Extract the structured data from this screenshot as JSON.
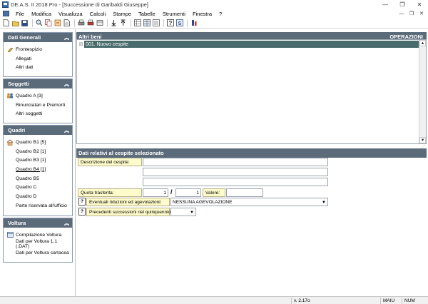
{
  "window": {
    "title": "DE.A.S. II 2018 Pro - [Successione di Garibaldi Giuseppe]",
    "minimize": "—",
    "restore": "❐",
    "close": "✕"
  },
  "menu": {
    "items": [
      "File",
      "Modifica",
      "Visualizza",
      "Calcoli",
      "Stampe",
      "Tabelle",
      "Strumenti",
      "Finestra",
      "?"
    ]
  },
  "toolbar": {
    "buttons": [
      "new-icon",
      "open-icon",
      "save-icon",
      "search-icon",
      "copy-icon",
      "cut-icon",
      "document-icon",
      "print-icon",
      "print-preview-icon",
      "archive-icon",
      "down-arrow-icon",
      "up-arrow-icon",
      "grid-icon",
      "table-icon",
      "list-icon",
      "help-icon",
      "calc-icon",
      "building-icon"
    ]
  },
  "left": {
    "groups": [
      {
        "title": "Dati Generali",
        "items": [
          {
            "label": "Frontespizio",
            "icon": "pen-icon",
            "underline": false
          },
          {
            "label": "Allegati",
            "icon": "",
            "underline": false
          },
          {
            "label": "Altri dati",
            "icon": "",
            "underline": false
          }
        ]
      },
      {
        "title": "Soggetti",
        "items": [
          {
            "label": "Quadro A [3]",
            "icon": "people-icon",
            "underline": false
          },
          {
            "label": "Rinunciatari e Premorti",
            "icon": "",
            "underline": false
          },
          {
            "label": "Altri soggetti",
            "icon": "",
            "underline": false
          }
        ]
      },
      {
        "title": "Quadri",
        "items": [
          {
            "label": "Quadro B1 [5]",
            "icon": "house-icon",
            "underline": false
          },
          {
            "label": "Quadro B2 [1]",
            "icon": "",
            "underline": false
          },
          {
            "label": "Quadro B3 [1]",
            "icon": "",
            "underline": false
          },
          {
            "label": "Quadro B4 [1]",
            "icon": "",
            "underline": true
          },
          {
            "label": "Quadro B5",
            "icon": "",
            "underline": false
          },
          {
            "label": "Quadro C",
            "icon": "",
            "underline": false
          },
          {
            "label": "Quadro D",
            "icon": "",
            "underline": false
          },
          {
            "label": "Parte riservata all'ufficio",
            "icon": "",
            "underline": false
          }
        ]
      },
      {
        "title": "Voltura",
        "items": [
          {
            "label": "Compilazione Voltura",
            "icon": "form-icon",
            "underline": false
          },
          {
            "label": "Dati per Voltura 1.1 (.DAT)",
            "icon": "",
            "underline": false
          },
          {
            "label": "Dati per Voltura cartacea",
            "icon": "",
            "underline": false
          }
        ]
      }
    ]
  },
  "main": {
    "section_title": "Altri beni",
    "operations_label": "OPERAZIONI",
    "tree_item": "001. Nuovo cespite",
    "details_title": "Dati relativi al cespite selezionato",
    "descrizione_label": "Descrizione del cespite:",
    "descrizione_line1": "",
    "descrizione_line2": "",
    "descrizione_line3": "",
    "quota_label": "Quota trasferita:",
    "quota_num": "1",
    "quota_den": "1",
    "quota_sep": "/",
    "valore_label": "Valore:",
    "valore_value": "",
    "riduzioni_label": "Eventuali riduzioni ed agevolazioni:",
    "riduzioni_value": "NESSUNA AGEVOLAZIONE",
    "precedenti_label": "Precedenti successioni nel quinquennio:",
    "precedenti_value": "",
    "help_glyph": "?"
  },
  "status": {
    "version": "v. 2.17o",
    "caps": "MAIU",
    "num": "NUM"
  }
}
